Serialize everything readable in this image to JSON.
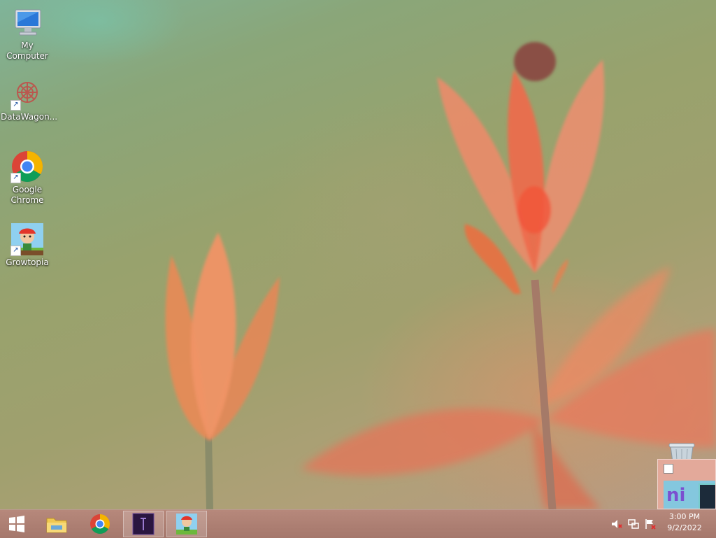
{
  "desktop": {
    "icons": [
      {
        "label": "My Computer",
        "icon": "computer-icon"
      },
      {
        "label": "DataWagon...",
        "icon": "datawagon-icon"
      },
      {
        "label": "Google Chrome",
        "icon": "chrome-icon"
      },
      {
        "label": "Growtopia",
        "icon": "growtopia-icon"
      }
    ]
  },
  "taskbar": {
    "start": {
      "icon": "windows-logo-icon"
    },
    "pinned": [
      {
        "name": "File Explorer",
        "icon": "folder-icon"
      },
      {
        "name": "Google Chrome",
        "icon": "chrome-icon"
      },
      {
        "name": "Terminal",
        "icon": "terminal-icon"
      },
      {
        "name": "Growtopia",
        "icon": "growtopia-icon"
      }
    ],
    "tray": {
      "icons": [
        "speaker-muted-icon",
        "network-icon",
        "action-center-flag-icon"
      ],
      "time": "3:00 PM",
      "date": "9/2/2022"
    }
  },
  "colors": {
    "taskbar": "#b07e70",
    "accent": "#ef7a55"
  }
}
